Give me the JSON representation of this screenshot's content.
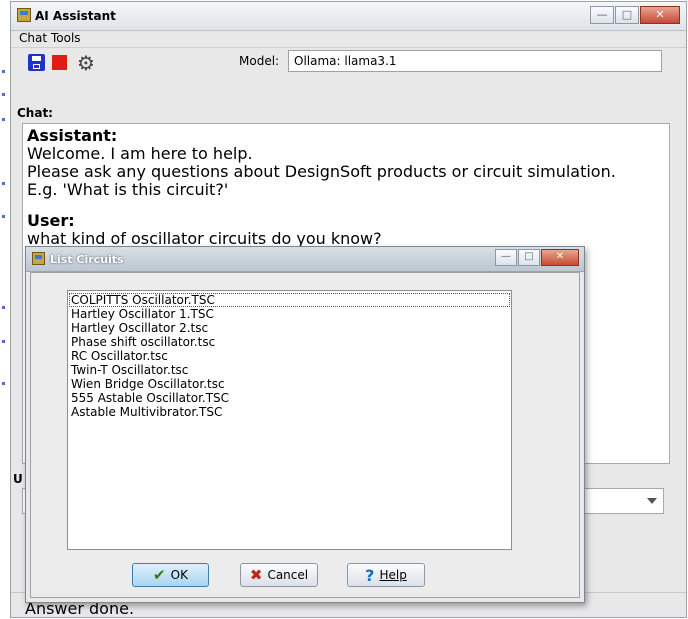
{
  "window": {
    "title": "AI Assistant"
  },
  "menubar": {
    "items": [
      "Chat",
      "Tools"
    ]
  },
  "toolbar": {
    "icons": [
      "save-icon",
      "stop-icon",
      "gear-icon"
    ],
    "model_label": "Model:",
    "model_value": "Ollama: llama3.1"
  },
  "chat": {
    "label": "Chat:",
    "assistant_header": "Assistant:",
    "assistant_lines": [
      "Welcome. I am here to help.",
      "Please ask any questions about DesignSoft products or circuit simulation.",
      "E.g. 'What is this circuit?'"
    ],
    "user_header": "User:",
    "user_line": "what kind of oscillator circuits do you know?"
  },
  "input": {
    "label_partial": "U"
  },
  "status": {
    "text": "Answer done."
  },
  "dialog": {
    "title": "List Circuits",
    "items": [
      "COLPITTS Oscillator.TSC",
      "Hartley Oscillator 1.TSC",
      "Hartley Oscillator 2.tsc",
      "Phase shift oscillator.tsc",
      "RC Oscillator.tsc",
      "Twin-T Oscillator.tsc",
      "Wien Bridge Oscillator.tsc",
      "555 Astable Oscillator.TSC",
      "Astable Multivibrator.TSC"
    ],
    "selected_index": 0,
    "ok_label": "OK",
    "cancel_label": "Cancel",
    "help_label": "Help"
  },
  "colors": {
    "ok_button": "#a9d4f2",
    "close_button": "#c64a34",
    "save_icon": "#1f33c9",
    "stop_icon": "#e31b16"
  }
}
